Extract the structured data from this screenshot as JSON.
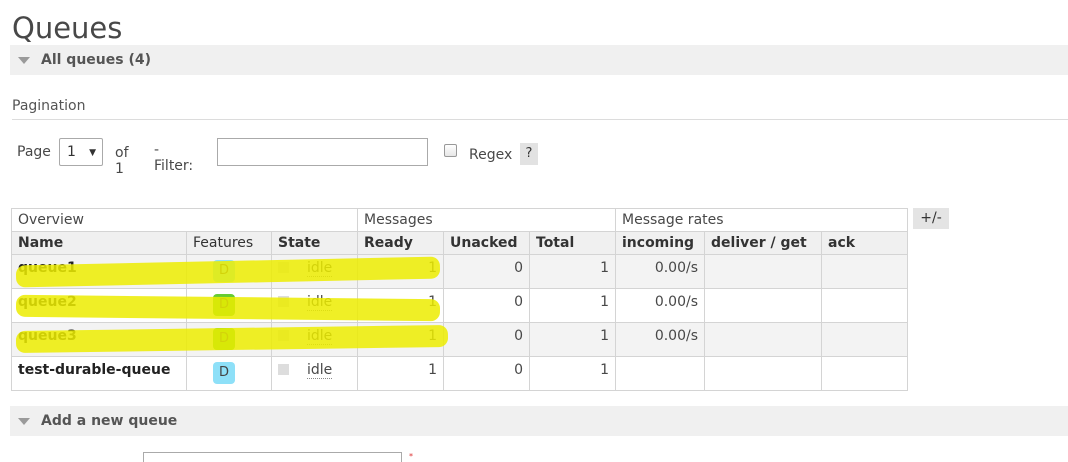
{
  "page": {
    "title": "Queues"
  },
  "sections": {
    "all_queues": "All queues (4)",
    "add_queue": "Add a new queue"
  },
  "pagination": {
    "title": "Pagination",
    "page_label": "Page",
    "page_value": "1",
    "of_label": "of 1",
    "filter_label": "- Filter:",
    "filter_value": "",
    "regex_label": "Regex",
    "regex_checked": false,
    "help_label": "?"
  },
  "table": {
    "groups": [
      "Overview",
      "Messages",
      "Message rates"
    ],
    "columns": [
      "Name",
      "Features",
      "State",
      "Ready",
      "Unacked",
      "Total",
      "incoming",
      "deliver / get",
      "ack"
    ],
    "rows": [
      {
        "name": "queue1",
        "feature": "D",
        "feature_color": "#8ee0f8",
        "state": "idle",
        "ready": "1",
        "unacked": "0",
        "total": "1",
        "incoming": "0.00/s",
        "deliver_get": "",
        "ack": ""
      },
      {
        "name": "queue2",
        "feature": "D",
        "feature_color": "#66cc33",
        "state": "idle",
        "ready": "1",
        "unacked": "0",
        "total": "1",
        "incoming": "0.00/s",
        "deliver_get": "",
        "ack": ""
      },
      {
        "name": "queue3",
        "feature": "D",
        "feature_color": "#66cc33",
        "state": "idle",
        "ready": "1",
        "unacked": "0",
        "total": "1",
        "incoming": "0.00/s",
        "deliver_get": "",
        "ack": ""
      },
      {
        "name": "test-durable-queue",
        "feature": "D",
        "feature_color": "#8ee0f8",
        "state": "idle",
        "ready": "1",
        "unacked": "0",
        "total": "1",
        "incoming": "",
        "deliver_get": "",
        "ack": ""
      }
    ],
    "column_toggle_label": "+/-"
  },
  "colors": {
    "highlight": "#ecec00",
    "section_bar": "#f0f0f0",
    "feature_durable_blue": "#8ee0f8",
    "feature_durable_green": "#66cc33"
  },
  "icons": {
    "section_toggle": "triangle-down-icon",
    "select_caret": "caret-down-icon"
  }
}
